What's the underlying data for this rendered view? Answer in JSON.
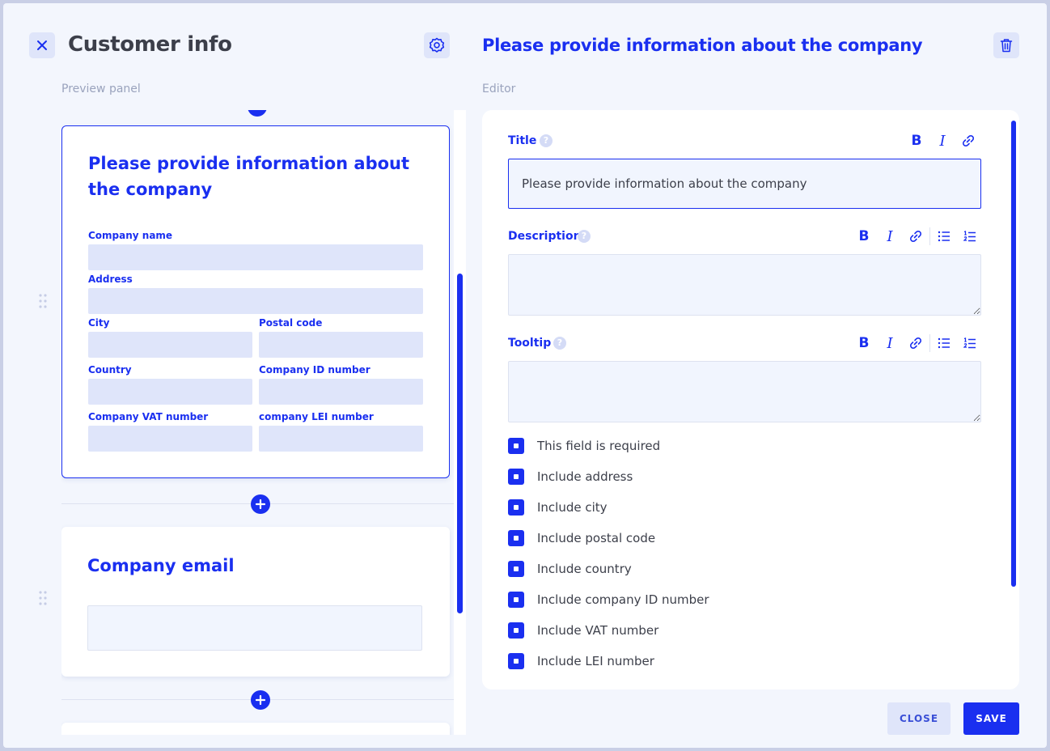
{
  "header": {
    "title": "Customer info",
    "editor_title": "Please provide information about the company"
  },
  "labels": {
    "preview": "Preview panel",
    "editor": "Editor"
  },
  "preview": {
    "card1": {
      "title": "Please provide information about the company",
      "fields": {
        "company_name": "Company name",
        "address": "Address",
        "city": "City",
        "postal_code": "Postal code",
        "country": "Country",
        "company_id": "Company ID number",
        "vat": "Company VAT number",
        "lei": "company LEI number"
      }
    },
    "card2": {
      "title": "Company email"
    }
  },
  "editor": {
    "title_label": "Title",
    "title_value": "Please provide information about the company",
    "description_label": "Description",
    "description_value": "",
    "tooltip_label": "Tooltip",
    "tooltip_value": "",
    "help_glyph": "?",
    "toolbar": {
      "bold": "B",
      "italic": "I"
    },
    "checkboxes": [
      "This field is required",
      "Include address",
      "Include city",
      "Include postal code",
      "Include country",
      "Include company ID number",
      "Include VAT number",
      "Include LEI number"
    ]
  },
  "buttons": {
    "close": "CLOSE",
    "save": "SAVE"
  },
  "colors": {
    "accent": "#1a2ff0",
    "field_fill": "#dfe5fa",
    "background": "#f3f6fd"
  },
  "icons": [
    "close-icon",
    "settings-icon",
    "trash-icon",
    "plus-icon",
    "drag-handle-icon",
    "bold-icon",
    "italic-icon",
    "link-icon",
    "bullet-list-icon",
    "numbered-list-icon",
    "help-icon"
  ]
}
